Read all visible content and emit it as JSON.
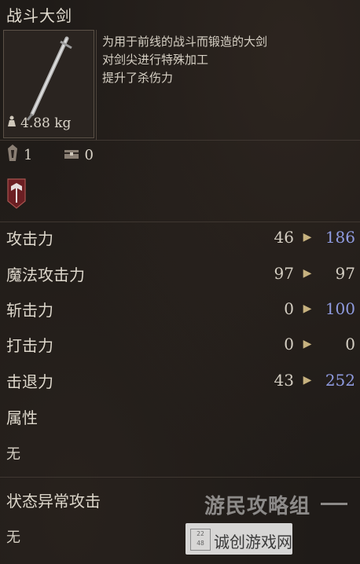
{
  "item": {
    "title": "战斗大剑",
    "weight": "4.88 kg",
    "description": [
      "为用于前线的战斗而锻造的大剑",
      "对剑尖进行特殊加工",
      "提升了杀伤力"
    ]
  },
  "slots": {
    "crystal_count": "1",
    "chest_count": "0"
  },
  "stats": [
    {
      "label": "攻击力",
      "base": "46",
      "upgraded": "186",
      "upgraded_color": "#8f9be0"
    },
    {
      "label": "魔法攻击力",
      "base": "97",
      "upgraded": "97",
      "upgraded_color": "#d5cfc3"
    },
    {
      "label": "斩击力",
      "base": "0",
      "upgraded": "100",
      "upgraded_color": "#8f9be0"
    },
    {
      "label": "打击力",
      "base": "0",
      "upgraded": "0",
      "upgraded_color": "#d5cfc3"
    },
    {
      "label": "击退力",
      "base": "43",
      "upgraded": "252",
      "upgraded_color": "#8f9be0"
    }
  ],
  "attribute": {
    "label": "属性",
    "value": "无"
  },
  "status": {
    "label": "状态异常攻击",
    "value": "无"
  },
  "watermarks": {
    "top": "游民攻略组",
    "bottom": "诚创游戏网",
    "logo": "2|2|4|8"
  }
}
